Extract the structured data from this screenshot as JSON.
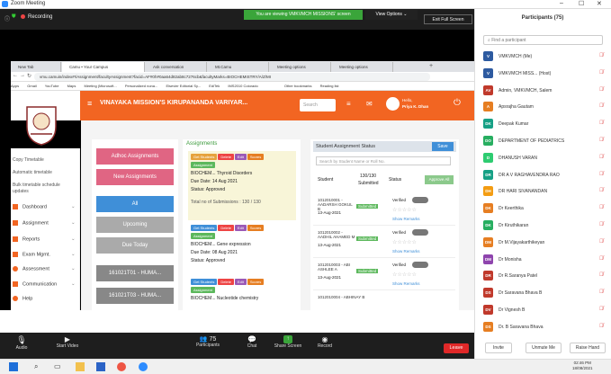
{
  "window": {
    "title": "Zoom Meeting",
    "min": "–",
    "max": "☐",
    "close": "✕"
  },
  "zoom_top": {
    "recording": "Recording",
    "viewing": "You are viewing VMKVMCH MISSIONS' screen",
    "view_options": "View Options ⌄",
    "exit_fullscreen": "Exit Full Screen"
  },
  "browser": {
    "tabs": [
      "New Tab",
      "Camu • Your Campus",
      "Ask conversation",
      "Mt.Camu",
      "Meeting options",
      "Meeting options"
    ],
    "url": "vmu.camuin/index#!/Assignment/facultyAssignment?facid=AF#0h#0aa64d82ab8c7276cb&facultyMarks=BIOCHEMISTRY/A/Z/MI",
    "bookmarks": [
      "Apps",
      "Gmail",
      "YouTube",
      "Maps",
      "Meeting (Microsoft...",
      "Personalized nona...",
      "Elsevier Editorial Sy...",
      "EdiTek",
      "IMS2010 Colorado",
      "Other bookmarks",
      "Reading list"
    ]
  },
  "app": {
    "title": "VINAYAKA MISSION'S KIRUPANANDA VARIYAR...",
    "search_placeholder": "Search",
    "user": "Priya K. Dhan",
    "user_sub": "Hello,"
  },
  "sidebar": {
    "items": [
      "Copy Timetable",
      "Automatic timetable",
      "Bulk timetable schedule updates"
    ],
    "menu": [
      "Dashboard",
      "Assignment",
      "Reports",
      "Exam Mgmt.",
      "Assessment",
      "Communication",
      "Help"
    ]
  },
  "left_buttons": [
    "Adhoc Assignments",
    "New Assignments",
    "All",
    "Upcoming",
    "Due Today",
    "161021T01 - HUMA...",
    "161021T03 - HUMA..."
  ],
  "assignments": {
    "heading": "Assignments",
    "cards": [
      {
        "title": "BIOCHEM... Thyroid Disorders",
        "due_label": "Due Date:",
        "due": "14 Aug 2021",
        "status_label": "Status:",
        "status": "Approved",
        "submissions": "Total no of Submissions : 130 / 130"
      },
      {
        "title": "BIOCHEM... Gene expression",
        "due_label": "Due Date:",
        "due": "08 Aug 2021",
        "status_label": "Status:",
        "status": "Approved"
      },
      {
        "title": "BIOCHEM... Nucleotide chemistry"
      }
    ],
    "btn_students": "Get Students",
    "btn_delete": "Delete",
    "btn_edit": "Edit",
    "btn_scores": "Scores",
    "btn_assign": "Assignment"
  },
  "student_status": {
    "heading": "Student Assignment Status",
    "save": "Save",
    "search_placeholder": "Search by Student Name or Roll No.",
    "student_label": "Student",
    "submitted_count": "130/130",
    "submitted_word": "Submitted",
    "status_label": "Status",
    "approve_all": "Approve All",
    "rows": [
      {
        "name": "1012010001 - AADARSH GOKUL B",
        "date": "13-Aug-2021",
        "state": "Submitted",
        "verified": "Verified",
        "remarks": "Show Remarks"
      },
      {
        "name": "1012010002 - AADHIL AHAMED M",
        "date": "13-Aug-2021",
        "state": "Submitted",
        "verified": "Verified",
        "remarks": "Show Remarks"
      },
      {
        "name": "1012010003 - ABI ASHLEE A",
        "date": "13-Aug-2021",
        "state": "Submitted",
        "verified": "Verified",
        "remarks": "Show Remarks"
      },
      {
        "name": "1012010004 - ABHINAY B",
        "date": "",
        "state": "",
        "verified": "",
        "remarks": ""
      }
    ]
  },
  "zoom_bottom": {
    "audio": "Audio",
    "video": "Start Video",
    "participants": "Participants",
    "participant_count": "75",
    "chat": "Chat",
    "share": "Share Screen",
    "record": "Record",
    "leave": "Leave"
  },
  "participants": {
    "heading": "Participants (75)",
    "search_placeholder": "Find a participant",
    "list": [
      {
        "initials": "V",
        "name": "VMKVMCH (Me)",
        "color": "#2d5aa0"
      },
      {
        "initials": "V",
        "name": "VMKVMCH MISS... (Host)",
        "color": "#2d5aa0"
      },
      {
        "initials": "AV",
        "name": "Admin, VMKVMCH, Salem",
        "color": "#c0392b"
      },
      {
        "initials": "A",
        "name": "Apsrajha Gautam",
        "color": "#e67e22"
      },
      {
        "initials": "DK",
        "name": "Deepak Kumar",
        "color": "#16a085"
      },
      {
        "initials": "DO",
        "name": "DEPARTMENT OF PEDIATRICS",
        "color": "#27ae60"
      },
      {
        "initials": "D",
        "name": "DHANUSH VARAN",
        "color": "#2ecc71"
      },
      {
        "initials": "DR",
        "name": "DR A V RAGHAVENDRA RAO",
        "color": "#16a085"
      },
      {
        "initials": "DH",
        "name": "DR HARI SIVANANDAN",
        "color": "#f39c12"
      },
      {
        "initials": "DK",
        "name": "Dr Keerthika",
        "color": "#e67e22"
      },
      {
        "initials": "DK",
        "name": "Dr Kiruthikaran",
        "color": "#27ae60"
      },
      {
        "initials": "DM",
        "name": "Dr M.Vijayakarthikeyan",
        "color": "#e67e22"
      },
      {
        "initials": "DM",
        "name": "Dr Monisha",
        "color": "#8e44ad"
      },
      {
        "initials": "DR",
        "name": "Dr R.Saranya Patel",
        "color": "#c0392b"
      },
      {
        "initials": "DS",
        "name": "Dr Saravana Bhava B",
        "color": "#c0392b"
      },
      {
        "initials": "DV",
        "name": "Dr Vignesh B",
        "color": "#c0392b"
      },
      {
        "initials": "DS",
        "name": "Dr. B Saravana Bhava",
        "color": "#e67e22"
      }
    ],
    "invite": "Invite",
    "unmute_me": "Unmute Me",
    "raise_hand": "Raise Hand"
  },
  "clock": {
    "time": "02:46 PM",
    "date": "18/08/2021"
  }
}
